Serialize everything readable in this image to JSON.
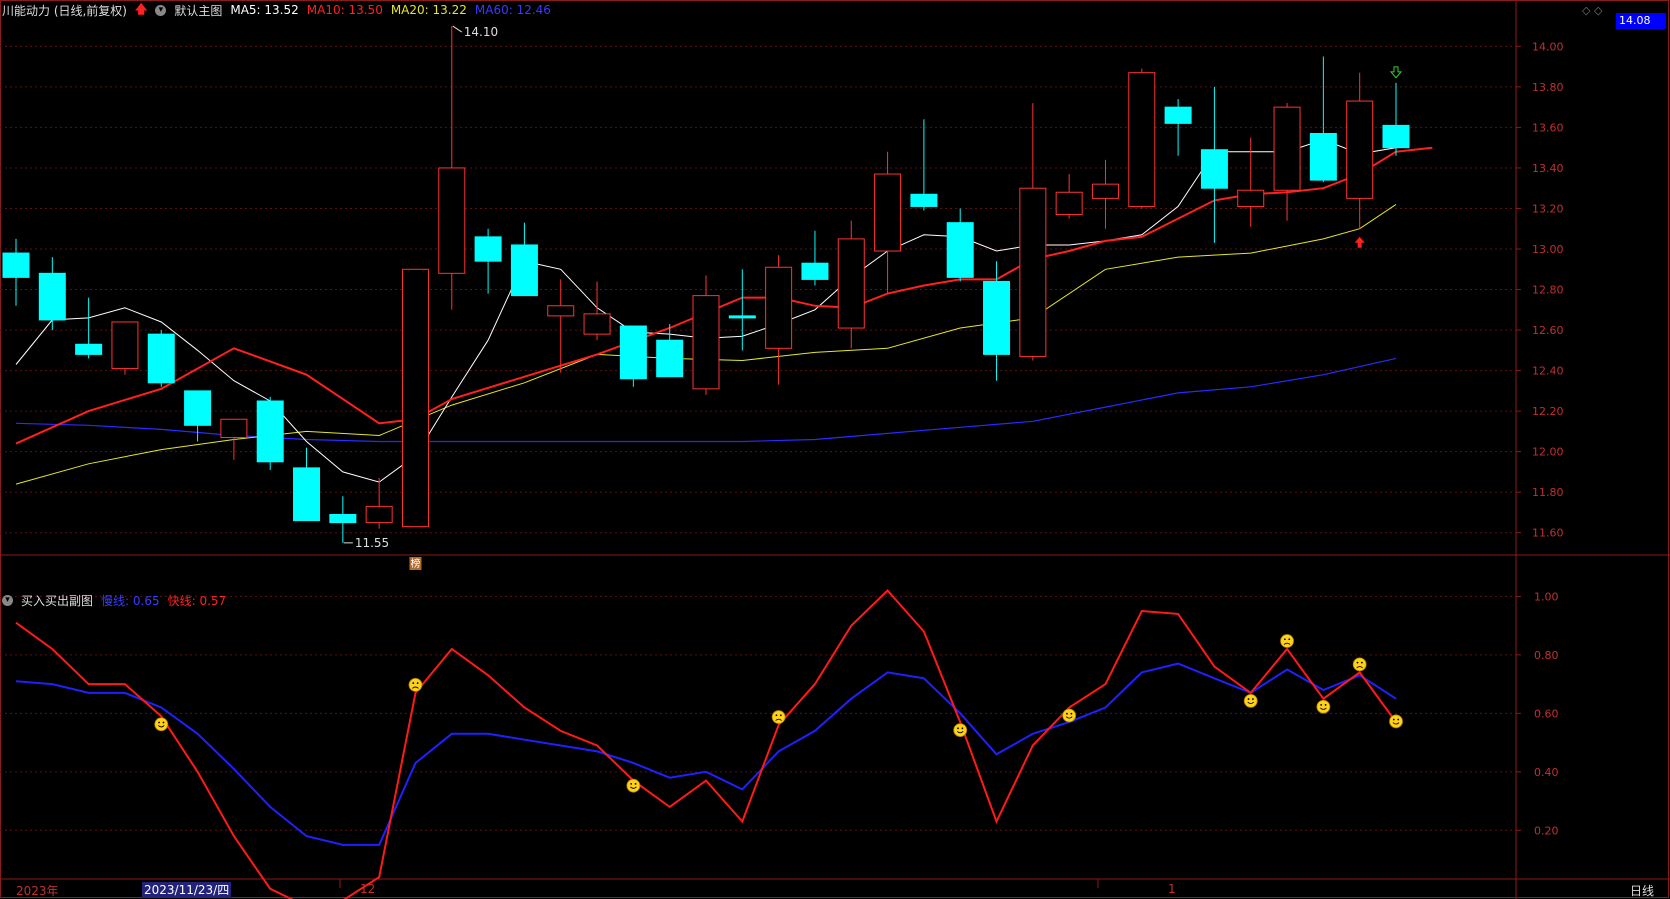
{
  "main_header": {
    "title": "川能动力 (日线,前复权)",
    "template": "默认主图",
    "ma5": "MA5: 13.52",
    "ma10": "MA10: 13.50",
    "ma20": "MA20: 13.22",
    "ma60": "MA60: 12.46",
    "colors": {
      "ma5": "#ffffff",
      "ma10": "#ff2020",
      "ma20": "#e6e62a",
      "ma60": "#2a2aff"
    }
  },
  "sub_header": {
    "title": "买入买出副图",
    "slow": "慢线: 0.65",
    "fast": "快线: 0.57"
  },
  "current_price": "14.08",
  "period": "日线",
  "selected_date": "2023/11/23/四",
  "top_icons": "◇ ◇",
  "x_labels": [
    {
      "text": "2023年",
      "x": 16
    },
    {
      "text": "12",
      "x": 345
    },
    {
      "text": "1",
      "x": 1098
    }
  ],
  "chart_data": {
    "type": "candlestick",
    "main": {
      "ylim": [
        11.5,
        14.13
      ],
      "y_ticks": [
        "14.00",
        "13.80",
        "13.60",
        "13.40",
        "13.20",
        "13.00",
        "12.80",
        "12.60",
        "12.40",
        "12.20",
        "12.00",
        "11.80",
        "11.60"
      ],
      "candles": [
        {
          "o": 12.98,
          "c": 12.86,
          "h": 13.05,
          "l": 12.72
        },
        {
          "o": 12.88,
          "c": 12.65,
          "h": 12.96,
          "l": 12.6
        },
        {
          "o": 12.53,
          "c": 12.48,
          "h": 12.76,
          "l": 12.46
        },
        {
          "o": 12.41,
          "c": 12.64,
          "h": 12.64,
          "l": 12.38
        },
        {
          "o": 12.58,
          "c": 12.34,
          "h": 12.6,
          "l": 12.32
        },
        {
          "o": 12.3,
          "c": 12.13,
          "h": 12.3,
          "l": 12.05
        },
        {
          "o": 12.07,
          "c": 12.16,
          "h": 12.16,
          "l": 11.96
        },
        {
          "o": 12.25,
          "c": 11.95,
          "h": 12.27,
          "l": 11.91
        },
        {
          "o": 11.92,
          "c": 11.66,
          "h": 12.02,
          "l": 11.66
        },
        {
          "o": 11.69,
          "c": 11.65,
          "h": 11.78,
          "l": 11.55
        },
        {
          "o": 11.65,
          "c": 11.73,
          "h": 11.87,
          "l": 11.62
        },
        {
          "o": 11.63,
          "c": 12.9,
          "h": 12.9,
          "l": 11.63
        },
        {
          "o": 12.88,
          "c": 13.4,
          "h": 14.1,
          "l": 12.7
        },
        {
          "o": 13.06,
          "c": 12.94,
          "h": 13.1,
          "l": 12.78
        },
        {
          "o": 13.02,
          "c": 12.77,
          "h": 13.13,
          "l": 12.77
        },
        {
          "o": 12.67,
          "c": 12.72,
          "h": 12.85,
          "l": 12.39
        },
        {
          "o": 12.58,
          "c": 12.68,
          "h": 12.84,
          "l": 12.55
        },
        {
          "o": 12.62,
          "c": 12.36,
          "h": 12.62,
          "l": 12.32
        },
        {
          "o": 12.55,
          "c": 12.37,
          "h": 12.63,
          "l": 12.37
        },
        {
          "o": 12.31,
          "c": 12.77,
          "h": 12.87,
          "l": 12.28
        },
        {
          "o": 12.67,
          "c": 12.66,
          "h": 12.9,
          "l": 12.5
        },
        {
          "o": 12.51,
          "c": 12.91,
          "h": 12.97,
          "l": 12.33
        },
        {
          "o": 12.93,
          "c": 12.85,
          "h": 13.09,
          "l": 12.82
        },
        {
          "o": 12.61,
          "c": 13.05,
          "h": 13.14,
          "l": 12.51
        },
        {
          "o": 12.99,
          "c": 13.37,
          "h": 13.48,
          "l": 12.78
        },
        {
          "o": 13.27,
          "c": 13.21,
          "h": 13.64,
          "l": 13.19
        },
        {
          "o": 13.13,
          "c": 12.86,
          "h": 13.2,
          "l": 12.84
        },
        {
          "o": 12.84,
          "c": 12.48,
          "h": 12.94,
          "l": 12.35
        },
        {
          "o": 12.47,
          "c": 13.3,
          "h": 13.72,
          "l": 12.45
        },
        {
          "o": 13.17,
          "c": 13.28,
          "h": 13.37,
          "l": 13.15
        },
        {
          "o": 13.25,
          "c": 13.32,
          "h": 13.44,
          "l": 13.1
        },
        {
          "o": 13.21,
          "c": 13.87,
          "h": 13.89,
          "l": 13.2
        },
        {
          "o": 13.7,
          "c": 13.62,
          "h": 13.74,
          "l": 13.46
        },
        {
          "o": 13.49,
          "c": 13.3,
          "h": 13.8,
          "l": 13.03
        },
        {
          "o": 13.21,
          "c": 13.29,
          "h": 13.55,
          "l": 13.11
        },
        {
          "o": 13.29,
          "c": 13.7,
          "h": 13.72,
          "l": 13.14
        },
        {
          "o": 13.57,
          "c": 13.34,
          "h": 13.95,
          "l": 13.33
        },
        {
          "o": 13.25,
          "c": 13.73,
          "h": 13.87,
          "l": 13.1
        },
        {
          "o": 13.61,
          "c": 13.5,
          "h": 13.82,
          "l": 13.46
        }
      ],
      "ma5": [
        12.43,
        12.65,
        12.66,
        12.71,
        12.64,
        12.5,
        12.35,
        12.25,
        12.05,
        11.9,
        11.85,
        11.98,
        12.27,
        12.55,
        12.94,
        12.9,
        12.71,
        12.59,
        12.58,
        12.56,
        12.57,
        12.63,
        12.7,
        12.86,
        12.99,
        13.07,
        13.06,
        12.99,
        13.02,
        13.02,
        13.04,
        13.07,
        13.21,
        13.48,
        13.48,
        13.48,
        13.54,
        13.47,
        13.5
      ],
      "ma10": [
        12.04,
        null,
        12.2,
        null,
        12.31,
        null,
        12.51,
        null,
        12.38,
        null,
        12.14,
        12.16,
        12.26,
        null,
        null,
        null,
        12.48,
        null,
        12.61,
        null,
        12.76,
        12.76,
        12.72,
        12.71,
        12.78,
        12.82,
        12.85,
        12.85,
        12.95,
        12.99,
        13.04,
        13.06,
        13.15,
        13.24,
        13.27,
        13.28,
        13.3,
        13.37,
        13.48,
        13.5
      ],
      "ma20": [
        11.84,
        null,
        11.94,
        null,
        12.01,
        null,
        12.06,
        null,
        12.1,
        null,
        12.08,
        null,
        12.23,
        null,
        12.34,
        null,
        12.48,
        null,
        12.46,
        null,
        12.45,
        null,
        12.49,
        null,
        12.51,
        null,
        12.61,
        null,
        12.66,
        null,
        12.9,
        null,
        12.96,
        null,
        12.98,
        null,
        13.05,
        13.1,
        13.22
      ],
      "ma60": [
        12.14,
        null,
        12.13,
        null,
        12.11,
        null,
        12.08,
        null,
        12.06,
        null,
        12.05,
        null,
        12.05,
        null,
        12.05,
        null,
        12.05,
        null,
        12.05,
        null,
        12.05,
        null,
        12.06,
        null,
        12.09,
        null,
        12.12,
        null,
        12.15,
        null,
        12.22,
        null,
        12.29,
        null,
        12.32,
        null,
        12.38,
        null,
        12.46
      ],
      "high_label": "14.10",
      "low_label": "11.55",
      "badge": "榜"
    },
    "sub": {
      "ylim": [
        0.03,
        1.08
      ],
      "y_ticks": [
        "1.00",
        "0.80",
        "0.60",
        "0.40",
        "0.20"
      ],
      "slow": [
        0.71,
        0.7,
        0.67,
        0.67,
        0.62,
        0.53,
        0.41,
        0.28,
        0.18,
        0.15,
        0.15,
        0.43,
        0.53,
        0.53,
        0.51,
        0.49,
        0.47,
        0.43,
        0.38,
        0.4,
        0.34,
        0.47,
        0.54,
        0.65,
        0.74,
        0.72,
        0.6,
        0.46,
        0.53,
        0.57,
        0.62,
        0.74,
        0.77,
        0.72,
        0.67,
        0.75,
        0.68,
        0.73,
        0.65
      ],
      "fast": [
        0.91,
        0.82,
        0.7,
        0.7,
        0.59,
        0.4,
        0.18,
        0.0,
        -0.06,
        -0.04,
        0.04,
        0.67,
        0.82,
        0.73,
        0.62,
        0.54,
        0.49,
        0.37,
        0.28,
        0.37,
        0.23,
        0.56,
        0.7,
        0.9,
        1.02,
        0.88,
        0.57,
        0.23,
        0.49,
        0.62,
        0.7,
        0.95,
        0.94,
        0.76,
        0.67,
        0.82,
        0.65,
        0.74,
        0.57
      ],
      "signals": [
        {
          "i": 4,
          "type": "smile"
        },
        {
          "i": 11,
          "type": "frown"
        },
        {
          "i": 17,
          "type": "smile"
        },
        {
          "i": 21,
          "type": "frown"
        },
        {
          "i": 26,
          "type": "smile"
        },
        {
          "i": 29,
          "type": "smile"
        },
        {
          "i": 34,
          "type": "smile"
        },
        {
          "i": 35,
          "type": "frown"
        },
        {
          "i": 36,
          "type": "smile"
        },
        {
          "i": 37,
          "type": "frown"
        },
        {
          "i": 38,
          "type": "smile"
        }
      ]
    }
  }
}
